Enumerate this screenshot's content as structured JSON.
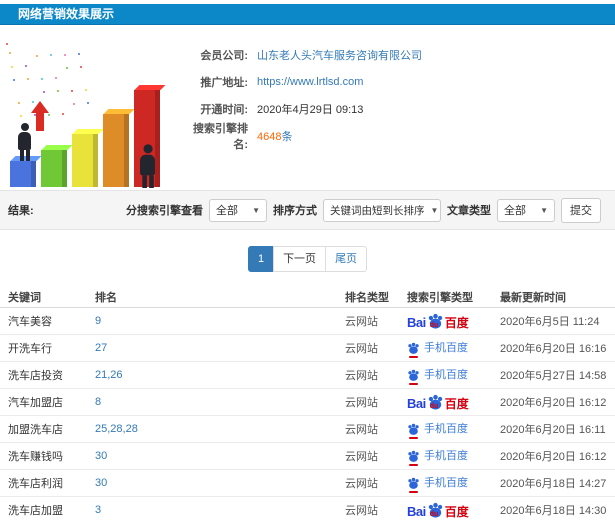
{
  "header": {
    "title": "网络营销效果展示"
  },
  "member": {
    "rows": [
      {
        "label": "会员公司:",
        "value": "山东老人头汽车服务咨询有限公司",
        "kind": "link"
      },
      {
        "label": "推广地址:",
        "value": "https://www.lrtlsd.com",
        "kind": "link"
      },
      {
        "label": "开通时间:",
        "value": "2020年4月29日 09:13",
        "kind": "text"
      },
      {
        "label": "搜索引擎排名:",
        "value": "4648",
        "suffix": "条",
        "kind": "rank"
      }
    ]
  },
  "filters": {
    "result_label": "结果:",
    "engine_label": "分搜索引擎查看",
    "engine_value": "全部",
    "sort_label": "排序方式",
    "sort_value": "关键词由短到长排序",
    "article_label": "文章类型",
    "article_value": "全部",
    "submit_label": "提交"
  },
  "pagination": {
    "current": "1",
    "next": "下一页",
    "last": "尾页"
  },
  "table": {
    "headers": [
      "关键词",
      "排名",
      "排名类型",
      "搜索引擎类型",
      "最新更新时间"
    ],
    "engine_labels": {
      "bai": "Bai",
      "du": "du",
      "cn": "百度",
      "mobile": "手机百度"
    },
    "rows": [
      {
        "keyword": "汽车美容",
        "rank": "9",
        "rank_type": "云网站",
        "engine": "baidu",
        "updated": "2020年6月5日 11:24"
      },
      {
        "keyword": "开洗车行",
        "rank": "27",
        "rank_type": "云网站",
        "engine": "mobile-baidu",
        "updated": "2020年6月20日 16:16"
      },
      {
        "keyword": "洗车店投资",
        "rank": "21,26",
        "rank_type": "云网站",
        "engine": "mobile-baidu",
        "updated": "2020年5月27日 14:58"
      },
      {
        "keyword": "汽车加盟店",
        "rank": "8",
        "rank_type": "云网站",
        "engine": "baidu",
        "updated": "2020年6月20日 16:12"
      },
      {
        "keyword": "加盟洗车店",
        "rank": "25,28,28",
        "rank_type": "云网站",
        "engine": "mobile-baidu",
        "updated": "2020年6月20日 16:11"
      },
      {
        "keyword": "洗车赚钱吗",
        "rank": "30",
        "rank_type": "云网站",
        "engine": "mobile-baidu",
        "updated": "2020年6月20日 16:12"
      },
      {
        "keyword": "洗车店利润",
        "rank": "30",
        "rank_type": "云网站",
        "engine": "mobile-baidu",
        "updated": "2020年6月18日 14:27"
      },
      {
        "keyword": "洗车店加盟",
        "rank": "3",
        "rank_type": "云网站",
        "engine": "baidu",
        "updated": "2020年6月18日 14:30"
      }
    ]
  },
  "colors": {
    "header_bg": "#0c87c8",
    "link": "#337ab7",
    "rank_count": "#ff6600",
    "baidu_blue": "#2442db",
    "baidu_red": "#d7000f",
    "mobile_baidu_blue": "#3a7bd5",
    "pagination_active": "#337ab7"
  }
}
